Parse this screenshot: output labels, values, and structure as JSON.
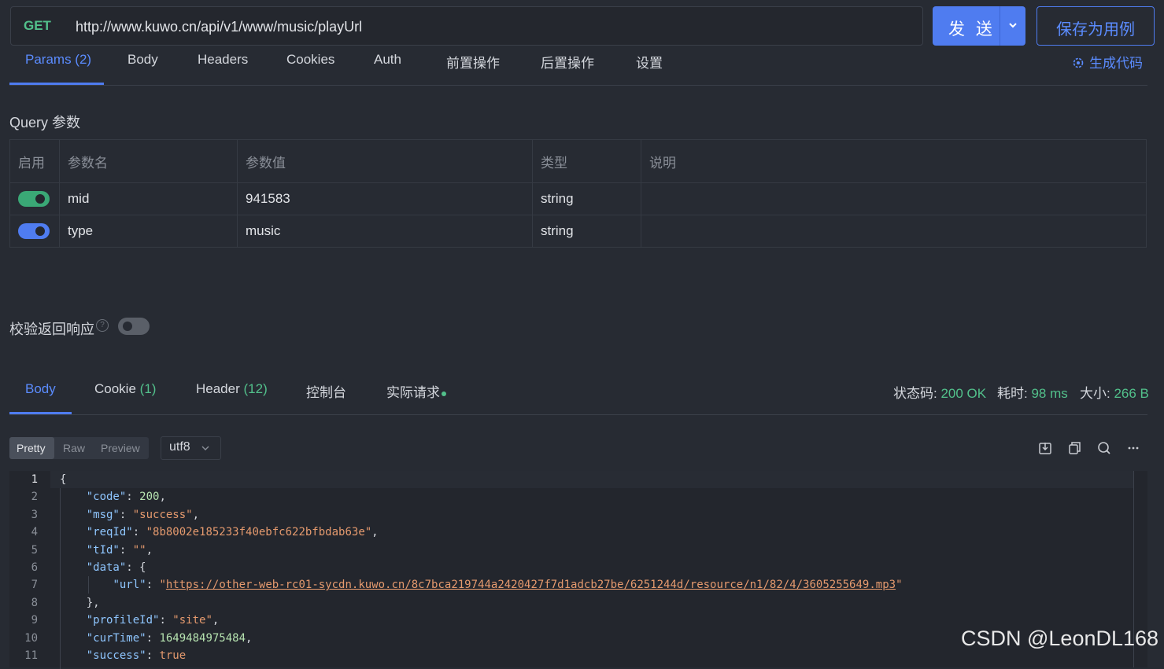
{
  "request": {
    "method": "GET",
    "url": "http://www.kuwo.cn/api/v1/www/music/playUrl",
    "send_label": "发 送",
    "save_label": "保存为用例"
  },
  "tabs": [
    {
      "label": "Params (2)"
    },
    {
      "label": "Body"
    },
    {
      "label": "Headers"
    },
    {
      "label": "Cookies"
    },
    {
      "label": "Auth"
    },
    {
      "label": "前置操作"
    },
    {
      "label": "后置操作"
    },
    {
      "label": "设置"
    }
  ],
  "generate_code_label": "生成代码",
  "query": {
    "title": "Query 参数",
    "headers": [
      "启用",
      "参数名",
      "参数值",
      "类型",
      "说明"
    ],
    "rows": [
      {
        "name": "mid",
        "value": "941583",
        "type": "string",
        "desc": "",
        "enabled": true
      },
      {
        "name": "type",
        "value": "music",
        "type": "string",
        "desc": "",
        "enabled": true
      }
    ]
  },
  "verify_label": "校验返回响应",
  "verify_help": "?",
  "response": {
    "tabs": [
      {
        "label": "Body",
        "count": ""
      },
      {
        "label": "Cookie",
        "count": "(1)"
      },
      {
        "label": "Header",
        "count": "(12)"
      },
      {
        "label": "控制台",
        "count": ""
      },
      {
        "label": "实际请求",
        "count": ""
      }
    ],
    "status_label": "状态码:",
    "status_value": "200 OK",
    "time_label": "耗时:",
    "time_value": "98 ms",
    "size_label": "大小:",
    "size_value": "266 B",
    "view_modes": [
      "Pretty",
      "Raw",
      "Preview"
    ],
    "encoding": "utf8"
  },
  "code_lines": [
    {
      "n": "1",
      "t": "{"
    },
    {
      "n": "2",
      "t": "    \"code\": 200,"
    },
    {
      "n": "3",
      "t": "    \"msg\": \"success\","
    },
    {
      "n": "4",
      "t": "    \"reqId\": \"8b8002e185233f40ebfc622bfbdab63e\","
    },
    {
      "n": "5",
      "t": "    \"tId\": \"\","
    },
    {
      "n": "6",
      "t": "    \"data\": {"
    },
    {
      "n": "7",
      "t": "        \"url\": \"https://other-web-rc01-sycdn.kuwo.cn/8c7bca219744a2420427f7d1adcb27be/6251244d/resource/n1/82/4/3605255649.mp3\""
    },
    {
      "n": "8",
      "t": "    },"
    },
    {
      "n": "9",
      "t": "    \"profileId\": \"site\","
    },
    {
      "n": "10",
      "t": "    \"curTime\": 1649484975484,"
    },
    {
      "n": "11",
      "t": "    \"success\": true"
    }
  ],
  "watermark": "CSDN @LeonDL168",
  "colors": {
    "accent": "#4f7cf0",
    "success": "#52c08b",
    "string": "#e59a6e",
    "key": "#8fc6ff"
  }
}
